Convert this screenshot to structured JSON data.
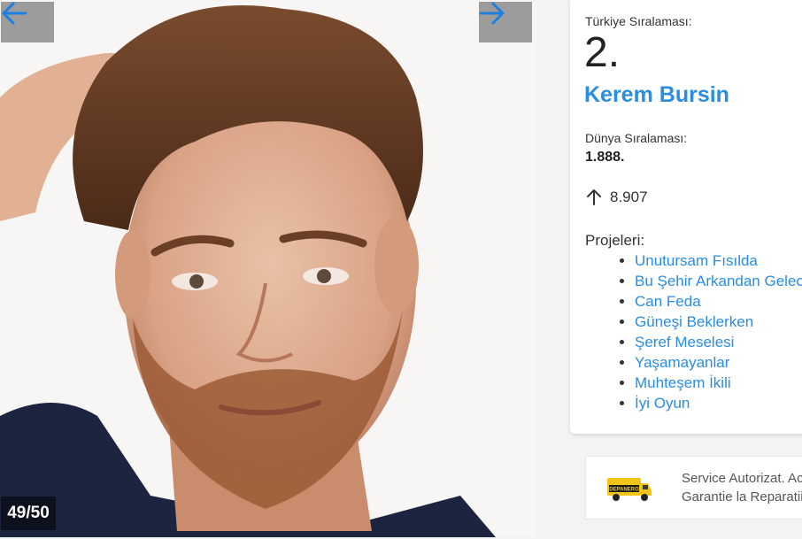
{
  "photo": {
    "counter": "49/50",
    "prev_icon": "arrow-left-icon",
    "next_icon": "arrow-right-icon"
  },
  "info": {
    "turkey_rank_label": "Türkiye Sıralaması:",
    "turkey_rank": "2.",
    "name": "Kerem Bursin",
    "world_rank_label": "Dünya Sıralaması:",
    "world_rank": "1.888.",
    "trend_icon": "arrow-up-icon",
    "trend_value": "8.907",
    "projects_label": "Projeleri:",
    "projects": [
      "Unutursam Fısılda",
      "Bu Şehir Arkandan Gelec",
      "Can Feda",
      "Güneşi Beklerken",
      "Şeref Meselesi",
      "Yaşamayanlar",
      "Muhteşem İkili",
      "İyi Oyun"
    ]
  },
  "ad": {
    "logo_text": "DEPANERO",
    "line1": "Service Autorizat. Ac",
    "line2": "Garantie la Reparatii"
  },
  "colors": {
    "link": "#2a8de0",
    "nav_arrow": "#1e7fe0"
  }
}
